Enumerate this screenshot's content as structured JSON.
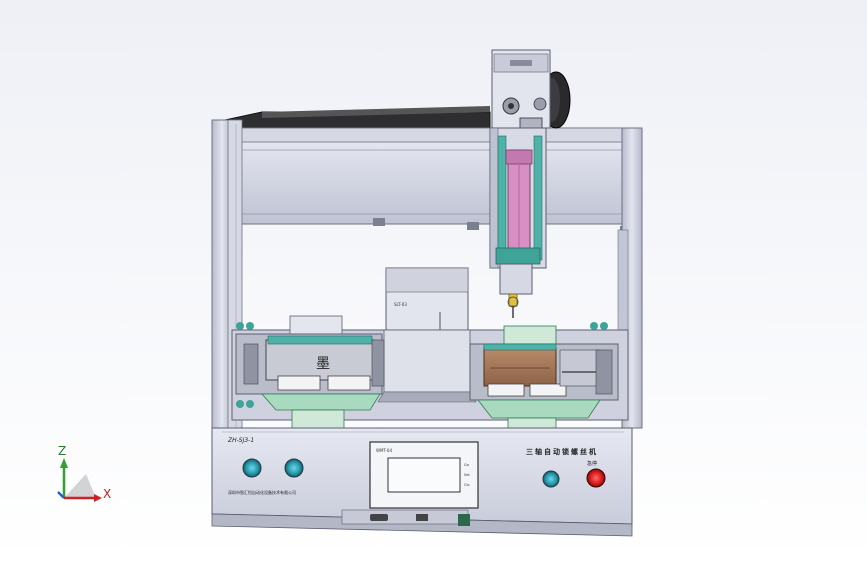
{
  "viewport": {
    "background_top": "#eef0f6",
    "background_bottom": "#ffffff"
  },
  "machine": {
    "model_label": "ZH-SJ3-1",
    "title_label": "三轴自动锁螺丝机",
    "company_label": "深圳市智汇恒自动化设备技术有限公司",
    "screen_brand": "WMT-04",
    "screen_buttons": [
      "Go",
      "Set",
      "Clo"
    ],
    "stop_button_label": "急停",
    "tray_label": "SLT-03",
    "fixture_left_glyph": "墨"
  },
  "axes": {
    "z_label": "Z",
    "x_label": "X",
    "colors": {
      "x": "#d02020",
      "y": "#2060d0",
      "z": "#30a030"
    }
  },
  "colors": {
    "frame": "#c8cbd8",
    "frame_dark": "#8a8ea0",
    "panel": "#dcdfea",
    "teal": "#4fb2a8",
    "pink": "#d78fc4",
    "wood": "#a8785a",
    "rail_dark": "#3a3a3a",
    "stop_red": "#e02020"
  }
}
